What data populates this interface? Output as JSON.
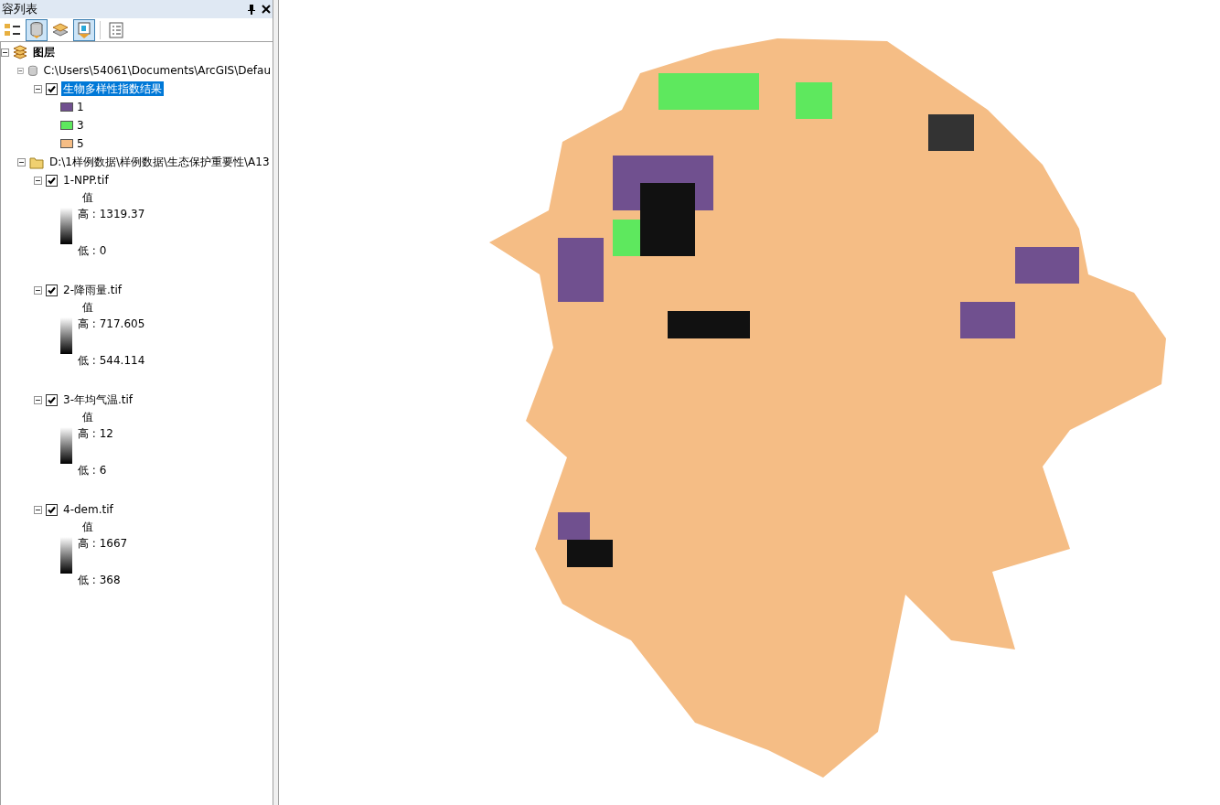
{
  "panel": {
    "title": "容列表"
  },
  "toolbar": [
    {
      "kind": "order",
      "selected": false
    },
    {
      "kind": "source",
      "selected": true
    },
    {
      "kind": "visibility",
      "selected": false
    },
    {
      "kind": "selection",
      "selected": true
    },
    {
      "kind": "options",
      "selected": false
    }
  ],
  "tree": [
    {
      "label": "图层",
      "kind": "root",
      "expanded": true,
      "children": [
        {
          "label": "C:\\Users\\54061\\Documents\\ArcGIS\\Defau",
          "kind": "database",
          "expanded": true,
          "children": [
            {
              "label": "生物多样性指数结果",
              "kind": "layer",
              "expanded": true,
              "checked": true,
              "selected": true,
              "legend": {
                "kind": "classes",
                "classes": [
                  {
                    "label": "1",
                    "color": "#70508f"
                  },
                  {
                    "label": "3",
                    "color": "#5ee85e"
                  },
                  {
                    "label": "5",
                    "color": "#f5bd85"
                  }
                ]
              }
            }
          ]
        },
        {
          "label": "D:\\1样例数据\\样例数据\\生态保护重要性\\A13",
          "kind": "folder",
          "expanded": true,
          "children": [
            {
              "label": "1-NPP.tif",
              "kind": "layer",
              "expanded": true,
              "checked": true,
              "selected": false,
              "legend": {
                "kind": "stretch",
                "heading": "值",
                "high": "高 : 1319.37",
                "low": "低 : 0"
              }
            },
            {
              "label": "2-降雨量.tif",
              "kind": "layer",
              "expanded": true,
              "checked": true,
              "selected": false,
              "legend": {
                "kind": "stretch",
                "heading": "值",
                "high": "高 : 717.605",
                "low": "低 : 544.114"
              }
            },
            {
              "label": "3-年均气温.tif",
              "kind": "layer",
              "expanded": true,
              "checked": true,
              "selected": false,
              "legend": {
                "kind": "stretch",
                "heading": "值",
                "high": "高 : 12",
                "low": "低 : 6"
              }
            },
            {
              "label": "4-dem.tif",
              "kind": "layer",
              "expanded": true,
              "checked": true,
              "selected": false,
              "legend": {
                "kind": "stretch",
                "heading": "值",
                "high": "高 : 1667",
                "low": "低 : 368"
              }
            }
          ]
        }
      ]
    }
  ]
}
